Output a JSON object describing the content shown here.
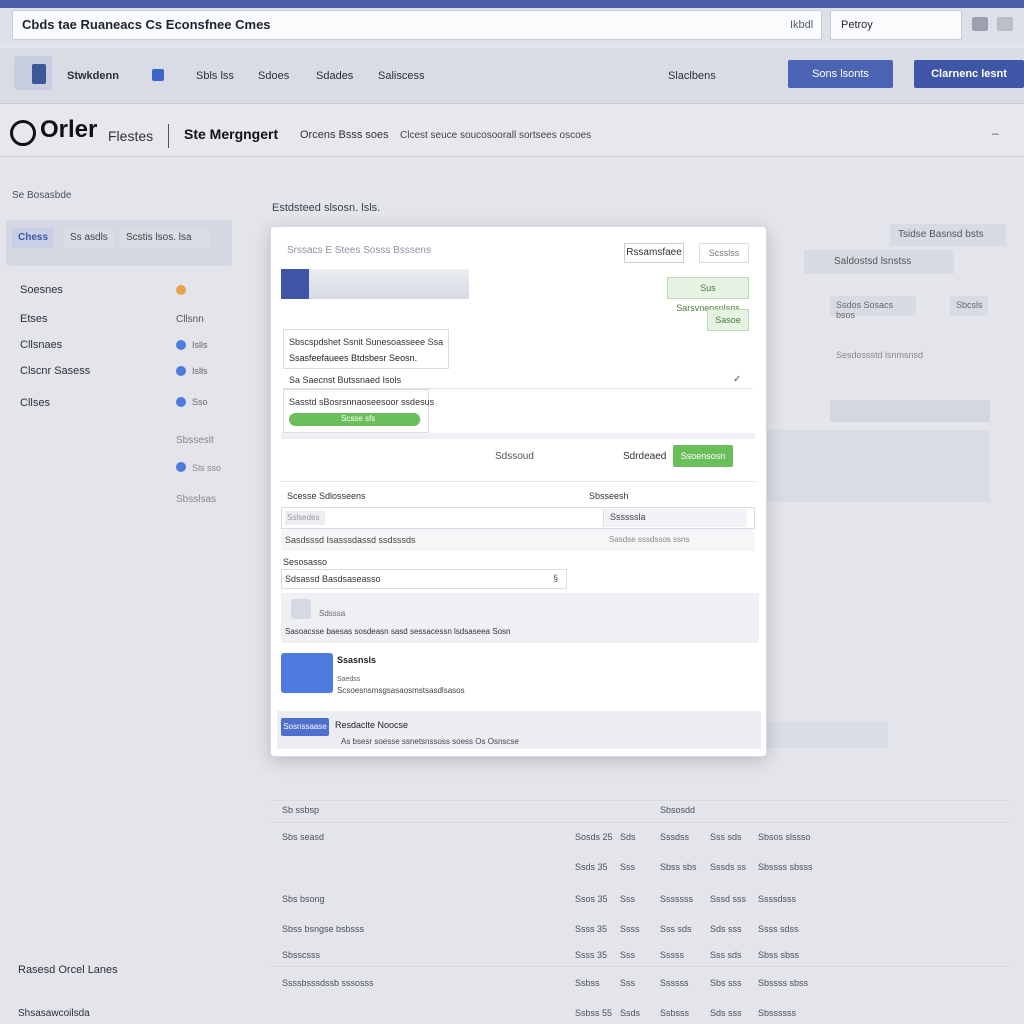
{
  "window": {
    "title": "Cbds tae Ruaneacs Cs Econsfnee Cmes",
    "search_label": "Ikbdl",
    "search_value": "Petroy"
  },
  "nav": {
    "brand": "Stwkdenn",
    "items": [
      "Sbls lss",
      "Sdoes",
      "Sdades",
      "Saliscess"
    ],
    "right_label": "Slaclbens",
    "button1": "Sons lsonts",
    "button2": "Clarnenc lesnt"
  },
  "order_header": {
    "logo": "Orler",
    "sub": "Flestes",
    "title": "Ste Mergngert",
    "tag": "Orcens Bsss soes",
    "desc": "Clcest seuce soucosoorall sortsees oscoes"
  },
  "sidebar": {
    "label": "Se Bosasbde",
    "search": {
      "tab": "Chess",
      "opt1": "Ss asdls",
      "opt2": "Scstis lsos. lsa"
    },
    "items": [
      {
        "label": "Soesnes",
        "meta": ""
      },
      {
        "label": "Etses",
        "meta": "Cllsnn"
      },
      {
        "label": "Cllsnaes",
        "meta": "Islls"
      },
      {
        "label": "Clscnr Sasess",
        "meta": "Islls"
      },
      {
        "label": "Cllses",
        "meta": "Sso"
      },
      {
        "label": "",
        "meta": "Sbsseslt"
      },
      {
        "label": "",
        "meta": "Sls sso"
      },
      {
        "label": "",
        "meta": "Sbsslsas"
      }
    ],
    "footer1": "Rasesd Orcel Lanes",
    "footer2": "Shsasawcoilsda"
  },
  "main": {
    "heading": "Estdsteed slsosn. lsls.",
    "right_top": "Tsidse Basnsd bsts",
    "right_2": "Saldostsd lsnstss",
    "right_3": "Ssdos Sosacs bsos",
    "right_3b": "Sbcsls",
    "right_4": "Sesdossstd lsnmsnsd"
  },
  "modal": {
    "header_ghost": "Srssacs E Stees Sosss Bsssens",
    "btn_add": "Rssamsfaee",
    "btn_small": "Scsslss",
    "badge1": "Sus Sarsvneosnlsns",
    "badge2": "Sasoe",
    "field_label1": "Sbscspdshet Ssnit Sunesoasseee Ssa",
    "field_value1": "Ssasfeefauees Btdsbesr Seosn.",
    "checkbox_label": "Sa Saecnst Butssnaed Isols",
    "card_title": "Sasstd sBosrsnnaoseesoor ssdesus",
    "progress_label": "Scsse sfs",
    "progress": 0.99,
    "btn_cancel": "Sdssoud",
    "btn_save_ghost": "Sdrdeaed",
    "btn_save": "Ssoensosn",
    "section_label": "Scesse Sdlosseens",
    "section_right": "Sbsseesh",
    "input_placeholder": "Sslsedes",
    "input_value": "Ssssssla",
    "hint1": "Sasdsssd Isasssdassd ssdsssds",
    "hint2": "Sasdse sssdssos ssns",
    "sub_label": "Sesosasso",
    "sub_value": "Sdsassd Basdsaseasso",
    "drop_label": "Sdsssa",
    "drop_desc": "Sasoacsse baesas sosdeasn sasd sessacessn lsdsaseea Sosn",
    "img_title": "Ssasnsls",
    "img_sub": "Saedss",
    "img_desc": "Scsoesnsmsgsasaosmstsasdlsasos",
    "footer_btn": "Sosnssaase",
    "footer_title": "Resdaclte Noocse",
    "footer_desc": "As bsesr soesse ssnetsnssoss soess Os Osnscse"
  },
  "table": {
    "headers": [
      "Sb ssbsp",
      "Sbsosdd"
    ],
    "rows": [
      {
        "name": "Sbs seasd",
        "c1": "Sosds 25",
        "c2": "Sds",
        "c3": "Sssdss",
        "c4": "Sss sds",
        "c5": "Sbsos slssso"
      },
      {
        "name": "",
        "c1": "Ssds 35",
        "c2": "Sss",
        "c3": "Sbss sbs",
        "c4": "Sssds ss",
        "c5": "Sbssss sbsss"
      },
      {
        "name": "Sbs bsong",
        "c1": "Ssos 35",
        "c2": "Sss",
        "c3": "Sssssss",
        "c4": "Sssd sss",
        "c5": "Ssssdsss"
      },
      {
        "name": "Sbss bsngse bsbsss",
        "c1": "Ssss 35",
        "c2": "Ssss",
        "c3": "Sss sds",
        "c4": "Sds sss",
        "c5": "Ssss sdss"
      },
      {
        "name": "Sbsscsss",
        "c1": "Ssss 35",
        "c2": "Sss",
        "c3": "Sssss",
        "c4": "Sss sds",
        "c5": "Sbss sbss"
      },
      {
        "name": "Ssssbsssdssb sssosss",
        "c1": "Ssbss",
        "c2": "Sss",
        "c3": "Ssssss",
        "c4": "Sbs sss",
        "c5": "Sbssss sbss"
      },
      {
        "name": "",
        "c1": "Ssbss 55",
        "c2": "Ssds",
        "c3": "Ssbsss",
        "c4": "Sds sss",
        "c5": "Sbssssss"
      }
    ]
  },
  "colors": {
    "accent": "#3f56a6",
    "green": "#6bbf5a",
    "blue": "#4f7be0"
  }
}
